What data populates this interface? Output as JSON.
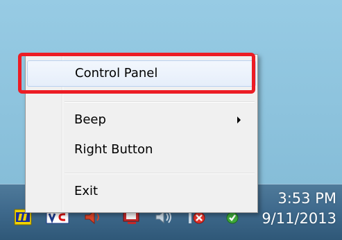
{
  "context_menu": {
    "items": [
      {
        "label": "Control Panel"
      },
      {
        "label": "Beep",
        "has_submenu": true
      },
      {
        "label": "Right Button"
      },
      {
        "label": "Exit"
      }
    ]
  },
  "tray": {
    "icons": [
      "app-yellow-icon",
      "vc-icon",
      "speaker-icon",
      "network-icon",
      "volume-icon",
      "action-center-error-icon",
      "security-ok-icon"
    ]
  },
  "clock": {
    "time": "3:53 PM",
    "date": "9/11/2013"
  },
  "colors": {
    "highlight": "#ec1c24",
    "desktop": "#8fc5df",
    "taskbar": "#3f6a8d"
  }
}
